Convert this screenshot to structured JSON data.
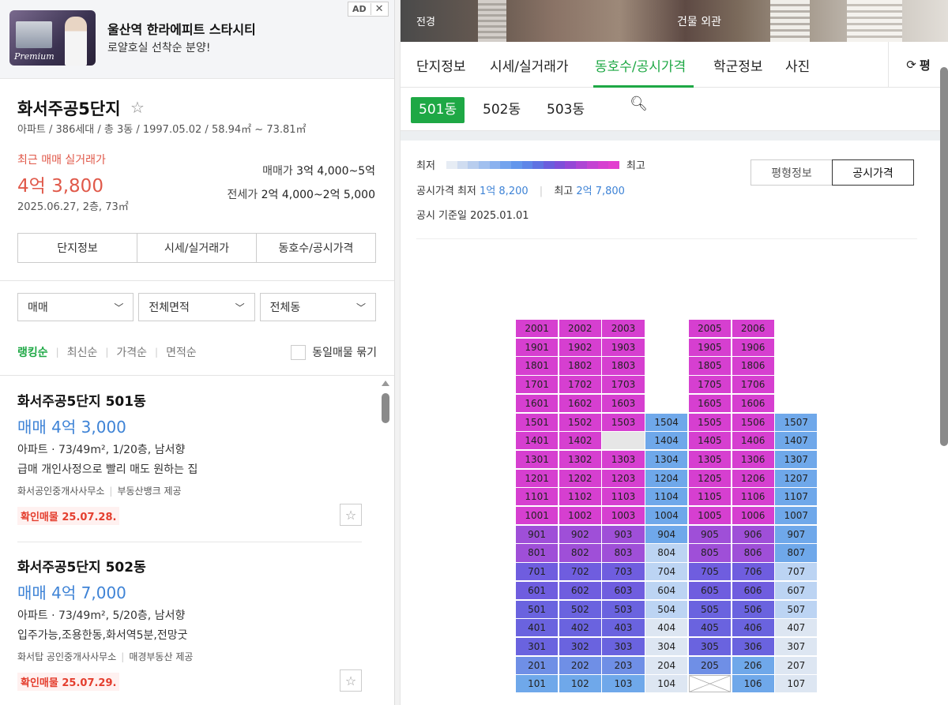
{
  "ad": {
    "title": "울산역 한라에피트 스타시티",
    "subtitle": "로얄호실 선착순 분양!",
    "badge": "AD",
    "close": "✕",
    "thumb_text": "Premium"
  },
  "complex": {
    "name": "화서주공5단지",
    "info": "아파트 / 386세대 / 총 3동 / 1997.05.02 / 58.94㎡ ~ 73.81㎡",
    "recent_label": "최근 매매 실거래가",
    "recent_price": "4억 3,800",
    "recent_date": "2025.06.27, 2층, 73㎡",
    "sale_label": "매매가",
    "sale_value": "3억 4,000~5억",
    "jeonse_label": "전세가",
    "jeonse_value": "2억 4,000~2억 5,000",
    "tabs": [
      "단지정보",
      "시세/실거래가",
      "동호수/공시가격"
    ]
  },
  "filters": [
    "매매",
    "전체면적",
    "전체동"
  ],
  "sort": {
    "options": [
      "랭킹순",
      "최신순",
      "가격순",
      "면적순"
    ],
    "active": 0,
    "group_label": "동일매물 묶기"
  },
  "listings": [
    {
      "title": "화서주공5단지 501동",
      "price": "매매 4억 3,000",
      "info": "아파트 · 73/49m², 1/20층, 남서향",
      "desc": "급매 개인사정으로 빨리 매도 원하는 집",
      "agent": "화서공인중개사사무소",
      "provider": "부동산뱅크 제공",
      "confirm": "확인매물 25.07.28."
    },
    {
      "title": "화서주공5단지 502동",
      "price": "매매 4억 7,000",
      "info": "아파트 · 73/49m², 5/20층, 남서향",
      "desc": "입주가능,조용한동,화서역5분,전망굿",
      "agent": "화서탑 공인중개사사무소",
      "provider": "매경부동산 제공",
      "confirm": "확인매물 25.07.29."
    }
  ],
  "photo": {
    "label_left": "전경",
    "label_right": "건물 외관"
  },
  "right_tabs": {
    "items": [
      "단지정보",
      "시세/실거래가",
      "동호수/공시가격",
      "학군정보",
      "사진"
    ],
    "active": 2,
    "refresh_label": "평"
  },
  "dongs": {
    "items": [
      "501동",
      "502동",
      "503동"
    ],
    "active": 0
  },
  "legend": {
    "low": "최저",
    "high": "최고",
    "colors": [
      "#e6ecf4",
      "#cfdcf0",
      "#b8cdee",
      "#a1c0ef",
      "#8ab2ef",
      "#73a4ee",
      "#6296ec",
      "#5e86e8",
      "#5f72e2",
      "#6a5ddd",
      "#7e4fd9",
      "#9548d6",
      "#ae45d4",
      "#c443d2",
      "#d63fd0",
      "#e23fcf"
    ],
    "min_label": "공시가격 최저",
    "min_value": "1억 8,200",
    "max_label": "최고",
    "max_value": "2억 7,800",
    "date_label": "공시 기준일",
    "date_value": "2025.01.01"
  },
  "view_toggle": {
    "items": [
      "평형정보",
      "공시가격"
    ],
    "active": 1
  },
  "unit_grid": {
    "columns": 7,
    "rows": [
      {
        "floor": 20,
        "units": [
          "2001",
          "2002",
          "2003",
          "",
          "2005",
          "2006",
          ""
        ]
      },
      {
        "floor": 19,
        "units": [
          "1901",
          "1902",
          "1903",
          "",
          "1905",
          "1906",
          ""
        ]
      },
      {
        "floor": 18,
        "units": [
          "1801",
          "1802",
          "1803",
          "",
          "1805",
          "1806",
          ""
        ]
      },
      {
        "floor": 17,
        "units": [
          "1701",
          "1702",
          "1703",
          "",
          "1705",
          "1706",
          ""
        ]
      },
      {
        "floor": 16,
        "units": [
          "1601",
          "1602",
          "1603",
          "",
          "1605",
          "1606",
          ""
        ]
      },
      {
        "floor": 15,
        "units": [
          "1501",
          "1502",
          "1503",
          "1504",
          "1505",
          "1506",
          "1507"
        ]
      },
      {
        "floor": 14,
        "units": [
          "1401",
          "1402",
          "",
          "1404",
          "1405",
          "1406",
          "1407"
        ]
      },
      {
        "floor": 13,
        "units": [
          "1301",
          "1302",
          "1303",
          "1304",
          "1305",
          "1306",
          "1307"
        ]
      },
      {
        "floor": 12,
        "units": [
          "1201",
          "1202",
          "1203",
          "1204",
          "1205",
          "1206",
          "1207"
        ]
      },
      {
        "floor": 11,
        "units": [
          "1101",
          "1102",
          "1103",
          "1104",
          "1105",
          "1106",
          "1107"
        ]
      },
      {
        "floor": 10,
        "units": [
          "1001",
          "1002",
          "1003",
          "1004",
          "1005",
          "1006",
          "1007"
        ]
      },
      {
        "floor": 9,
        "units": [
          "901",
          "902",
          "903",
          "904",
          "905",
          "906",
          "907"
        ]
      },
      {
        "floor": 8,
        "units": [
          "801",
          "802",
          "803",
          "804",
          "805",
          "806",
          "807"
        ]
      },
      {
        "floor": 7,
        "units": [
          "701",
          "702",
          "703",
          "704",
          "705",
          "706",
          "707"
        ]
      },
      {
        "floor": 6,
        "units": [
          "601",
          "602",
          "603",
          "604",
          "605",
          "606",
          "607"
        ]
      },
      {
        "floor": 5,
        "units": [
          "501",
          "502",
          "503",
          "504",
          "505",
          "506",
          "507"
        ]
      },
      {
        "floor": 4,
        "units": [
          "401",
          "402",
          "403",
          "404",
          "405",
          "406",
          "407"
        ]
      },
      {
        "floor": 3,
        "units": [
          "301",
          "302",
          "303",
          "304",
          "305",
          "306",
          "307"
        ]
      },
      {
        "floor": 2,
        "units": [
          "201",
          "202",
          "203",
          "204",
          "205",
          "206",
          "207"
        ]
      },
      {
        "floor": 1,
        "units": [
          "101",
          "102",
          "103",
          "104",
          "",
          "106",
          "107"
        ]
      }
    ],
    "blank_units": [
      "1403"
    ],
    "crossed_units": [
      "105"
    ],
    "palette": {
      "magenta": "#d63fd0",
      "purple_hi": "#9f4fd8",
      "purple": "#8a55dc",
      "violet": "#6f5ddf",
      "indigo": "#6a63df",
      "blue": "#6f8fe6",
      "sky": "#6fa8ea",
      "light": "#bcd4f3",
      "pale": "#dde6f2",
      "blank": "#e6e6e6"
    }
  }
}
